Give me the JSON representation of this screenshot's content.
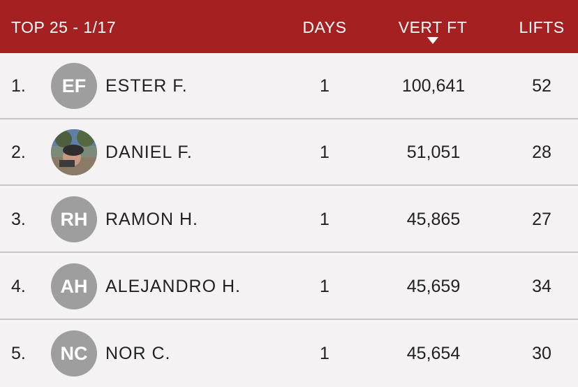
{
  "header": {
    "title": "TOP 25 - 1/17",
    "col_days": "DAYS",
    "col_vert": "VERT FT",
    "col_lifts": "LIFTS",
    "sort_indicator": "sort-descending-icon"
  },
  "colors": {
    "header_bg": "#a52121",
    "row_bg": "#f4f2f2",
    "avatar_bg": "#9e9e9e",
    "divider": "#c9c5c5"
  },
  "rows": [
    {
      "rank": "1.",
      "initials": "EF",
      "name": "ESTER F.",
      "days": "1",
      "vert": "100,641",
      "lifts": "52",
      "has_photo": false
    },
    {
      "rank": "2.",
      "initials": "",
      "name": "DANIEL F.",
      "days": "1",
      "vert": "51,051",
      "lifts": "28",
      "has_photo": true
    },
    {
      "rank": "3.",
      "initials": "RH",
      "name": "RAMON H.",
      "days": "1",
      "vert": "45,865",
      "lifts": "27",
      "has_photo": false
    },
    {
      "rank": "4.",
      "initials": "AH",
      "name": "ALEJANDRO H.",
      "days": "1",
      "vert": "45,659",
      "lifts": "34",
      "has_photo": false
    },
    {
      "rank": "5.",
      "initials": "NC",
      "name": "NOR C.",
      "days": "1",
      "vert": "45,654",
      "lifts": "30",
      "has_photo": false
    }
  ]
}
